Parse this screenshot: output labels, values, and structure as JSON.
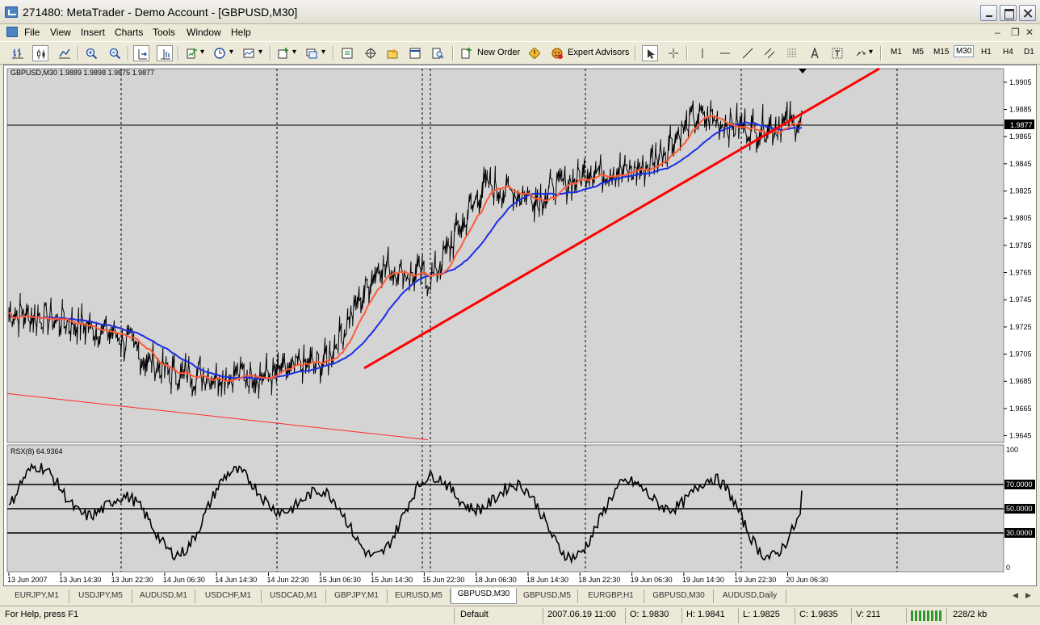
{
  "window": {
    "title": "271480: MetaTrader - Demo Account - [GBPUSD,M30]"
  },
  "menu": [
    "File",
    "View",
    "Insert",
    "Charts",
    "Tools",
    "Window",
    "Help"
  ],
  "toolbar": {
    "new_order": "New Order",
    "expert_advisors": "Expert Advisors",
    "timeframes": [
      "M1",
      "M5",
      "M15",
      "M30",
      "H1",
      "H4",
      "D1"
    ],
    "active_timeframe": "M30"
  },
  "chart": {
    "header": "GBPUSD,M30  1.9889 1.9898 1.9875 1.9877",
    "current_price": "1.9877",
    "price_ticks": [
      "1.9905",
      "1.9885",
      "1.9865",
      "1.9845",
      "1.9825",
      "1.9805",
      "1.9785",
      "1.9765",
      "1.9745",
      "1.9725",
      "1.9705",
      "1.9685",
      "1.9665",
      "1.9645"
    ],
    "indicator_label": "RSX(8)  64.9364",
    "indicator_levels": [
      "70.0000",
      "50.0000",
      "30.0000"
    ],
    "indicator_scale": [
      "100",
      "0"
    ],
    "time_ticks": [
      "13 Jun 2007",
      "13 Jun 14:30",
      "13 Jun 22:30",
      "14 Jun 06:30",
      "14 Jun 14:30",
      "14 Jun 22:30",
      "15 Jun 06:30",
      "15 Jun 14:30",
      "15 Jun 22:30",
      "18 Jun 06:30",
      "18 Jun 14:30",
      "18 Jun 22:30",
      "19 Jun 06:30",
      "19 Jun 14:30",
      "19 Jun 22:30",
      "20 Jun 06:30"
    ],
    "colors": {
      "background": "#d4d4d4",
      "candles": "#000000",
      "ma_fast": "#ff5a36",
      "ma_slow": "#1a2ee6",
      "trendline": "#ff0000"
    }
  },
  "chart_data": {
    "type": "line",
    "title": "GBPUSD,M30",
    "series": [
      {
        "name": "GBPUSD close",
        "x": [
          "13 Jun 2007",
          "13 Jun 14:30",
          "13 Jun 22:30",
          "14 Jun 06:30",
          "14 Jun 14:30",
          "14 Jun 22:30",
          "15 Jun 06:30",
          "15 Jun 14:30",
          "15 Jun 22:30",
          "18 Jun 06:30",
          "18 Jun 14:30",
          "18 Jun 22:30",
          "19 Jun 06:30",
          "19 Jun 14:30",
          "19 Jun 22:30",
          "20 Jun 06:30"
        ],
        "values": [
          1.9735,
          1.973,
          1.972,
          1.969,
          1.969,
          1.969,
          1.97,
          1.977,
          1.976,
          1.983,
          1.982,
          1.984,
          1.984,
          1.988,
          1.987,
          1.9877
        ]
      }
    ],
    "ylim": [
      1.964,
      1.9915
    ],
    "indicator": {
      "name": "RSX(8)",
      "last": 64.9364,
      "levels": [
        70,
        50,
        30
      ],
      "ylim": [
        0,
        100
      ]
    }
  },
  "tabs": [
    "EURJPY,M1",
    "USDJPY,M5",
    "AUDUSD,M1",
    "USDCHF,M1",
    "USDCAD,M1",
    "GBPJPY,M1",
    "EURUSD,M5",
    "GBPUSD,M30",
    "GBPUSD,M5",
    "EURGBP,H1",
    "GBPUSD,M30",
    "AUDUSD,Daily"
  ],
  "active_tab": "GBPUSD,M30",
  "status": {
    "help": "For Help, press F1",
    "profile": "Default",
    "time": "2007.06.19 11:00",
    "open": "O: 1.9830",
    "high": "H: 1.9841",
    "low": "L: 1.9825",
    "close": "C: 1.9835",
    "volume": "V: 211",
    "traffic": "228/2 kb"
  }
}
